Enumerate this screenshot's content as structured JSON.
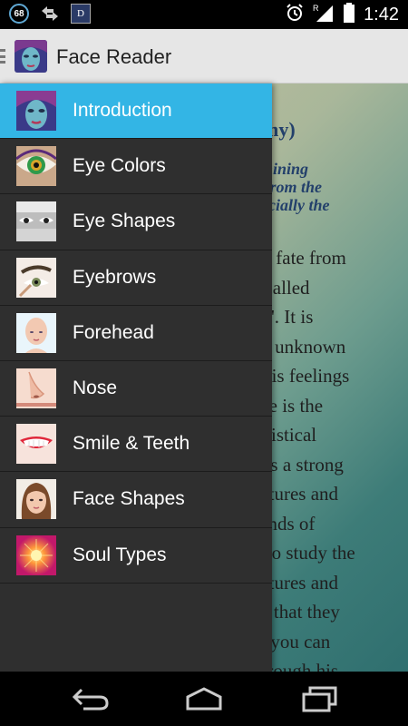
{
  "status_bar": {
    "notification_count": "68",
    "app_mini_icon_letter": "D",
    "time": "1:42",
    "icons": [
      "sync-icon",
      "alarm-icon",
      "signal-roaming-icon",
      "signal-icon",
      "battery-icon"
    ]
  },
  "action_bar": {
    "title": "Face Reader",
    "icon": "face-portrait-icon"
  },
  "content": {
    "heading": "omy)",
    "subtitle_lines": [
      "ermining",
      "es from the",
      "specially the"
    ],
    "body_lines": [
      "nd fate from",
      "s called",
      "ng'. It is",
      "an unknown",
      "l his feelings",
      "ace is the",
      "tatistical",
      "e is a strong",
      "eatures and",
      "sands of",
      "g to study the",
      "eatures and",
      "gs that they",
      "at you can",
      "through his"
    ]
  },
  "drawer": {
    "items": [
      {
        "label": "Introduction",
        "icon": "portrait-thumb",
        "active": true
      },
      {
        "label": "Eye Colors",
        "icon": "eye-color-thumb",
        "active": false
      },
      {
        "label": "Eye Shapes",
        "icon": "eye-shapes-thumb",
        "active": false
      },
      {
        "label": "Eyebrows",
        "icon": "eyebrow-thumb",
        "active": false
      },
      {
        "label": "Forehead",
        "icon": "forehead-thumb",
        "active": false
      },
      {
        "label": "Nose",
        "icon": "nose-thumb",
        "active": false
      },
      {
        "label": "Smile & Teeth",
        "icon": "smile-thumb",
        "active": false
      },
      {
        "label": "Face Shapes",
        "icon": "face-shape-thumb",
        "active": false
      },
      {
        "label": "Soul Types",
        "icon": "soul-thumb",
        "active": false
      }
    ]
  },
  "nav_bar": {
    "buttons": [
      "back-icon",
      "home-icon",
      "recent-apps-icon"
    ]
  },
  "colors": {
    "accent": "#33b5e5",
    "drawer_bg": "#2f2f2f",
    "heading_blue": "#23406b"
  }
}
